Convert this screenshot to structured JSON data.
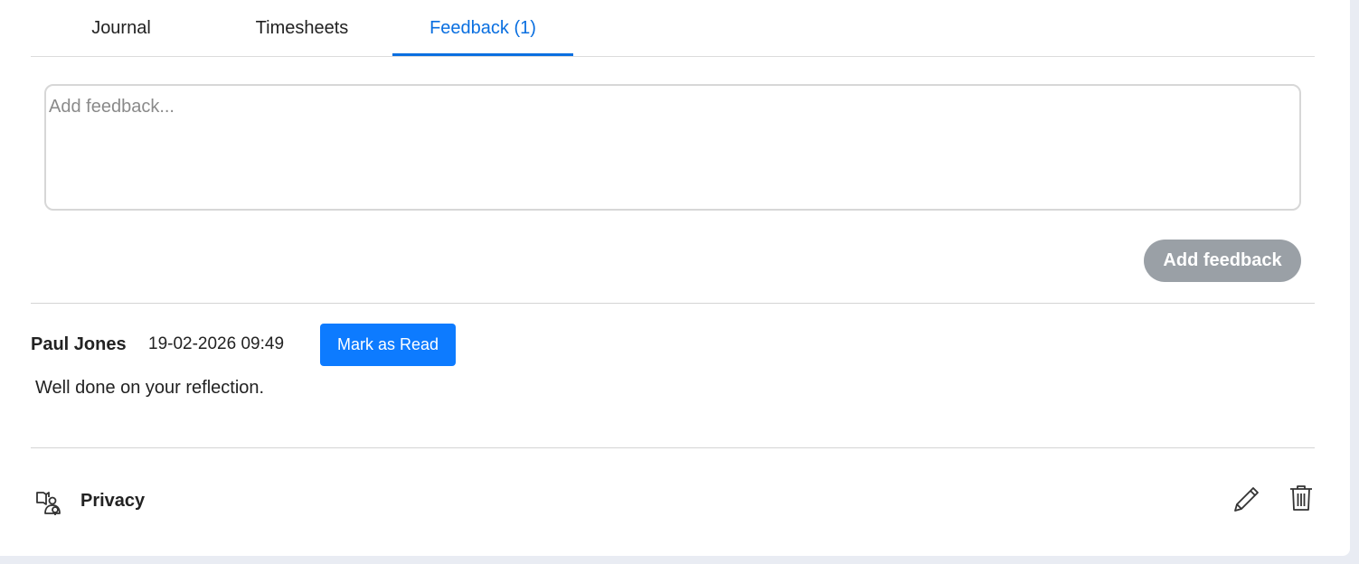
{
  "tabs": [
    {
      "label": "Journal"
    },
    {
      "label": "Timesheets"
    },
    {
      "label": "Feedback (1)"
    }
  ],
  "feedback_form": {
    "placeholder": "Add feedback...",
    "value": "",
    "submit_label": "Add feedback"
  },
  "feedback_item": {
    "author": "Paul Jones",
    "timestamp": "19-02-2026 09:49",
    "mark_read_label": "Mark as Read",
    "message": "Well done on your reflection."
  },
  "footer": {
    "privacy_label": "Privacy"
  },
  "colors": {
    "accent": "#0a6fe0",
    "button_primary": "#0d7bff",
    "button_disabled": "#9aa0a6"
  },
  "icons": {
    "privacy": "privacy-icon",
    "edit": "pencil-icon",
    "delete": "trash-icon"
  }
}
